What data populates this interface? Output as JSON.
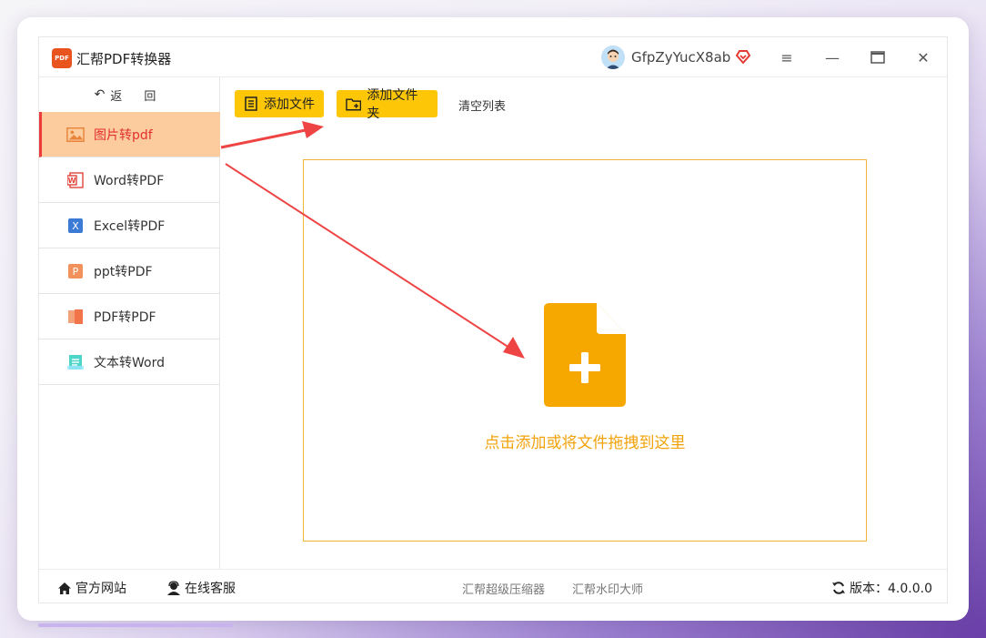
{
  "app": {
    "title": "汇帮PDF转换器",
    "logo_text": "PDF",
    "username": "GfpZyYucX8ab"
  },
  "window_controls": {
    "menu": "≡",
    "minimize": "—",
    "maximize": "☐",
    "close": "✕"
  },
  "sidebar": {
    "back": "返 回",
    "items": [
      {
        "label": "图片转pdf",
        "icon": "image-icon",
        "active": true
      },
      {
        "label": "Word转PDF",
        "icon": "word-icon"
      },
      {
        "label": "Excel转PDF",
        "icon": "excel-icon"
      },
      {
        "label": "ppt转PDF",
        "icon": "ppt-icon"
      },
      {
        "label": "PDF转PDF",
        "icon": "pdf-icon"
      },
      {
        "label": "文本转Word",
        "icon": "text-icon"
      }
    ]
  },
  "toolbar": {
    "add_file": "添加文件",
    "add_folder": "添加文件夹",
    "clear_list": "清空列表"
  },
  "dropzone": {
    "text": "点击添加或将文件拖拽到这里"
  },
  "footer": {
    "website": "官方网站",
    "support": "在线客服",
    "link1": "汇帮超级压缩器",
    "link2": "汇帮水印大师",
    "version": "版本：4.0.0.0"
  },
  "colors": {
    "accent_yellow": "#fdc607",
    "active_bg": "#fdcc9e",
    "active_text": "#e2302d",
    "drop_orange": "#f2a20a",
    "arrow_red": "#ef4444"
  }
}
